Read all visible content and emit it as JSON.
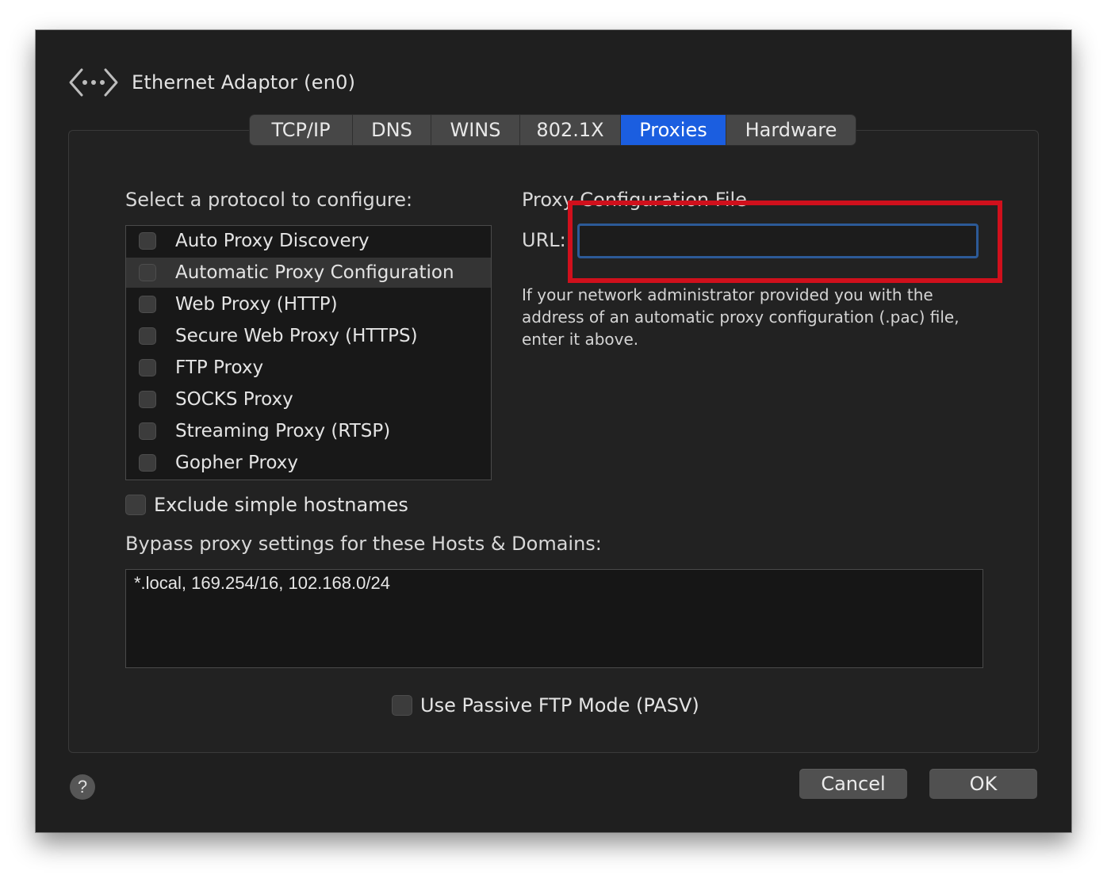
{
  "window": {
    "adaptor_icon": "network-arrows-icon",
    "title": "Ethernet Adaptor (en0)"
  },
  "tabs": [
    {
      "label": "TCP/IP",
      "active": false
    },
    {
      "label": "DNS",
      "active": false
    },
    {
      "label": "WINS",
      "active": false
    },
    {
      "label": "802.1X",
      "active": false
    },
    {
      "label": "Proxies",
      "active": true
    },
    {
      "label": "Hardware",
      "active": false
    }
  ],
  "protocols": {
    "heading": "Select a protocol to configure:",
    "items": [
      {
        "label": "Auto Proxy Discovery",
        "checked": false,
        "selected": false
      },
      {
        "label": "Automatic Proxy Configuration",
        "checked": false,
        "selected": true
      },
      {
        "label": "Web Proxy (HTTP)",
        "checked": false,
        "selected": false
      },
      {
        "label": "Secure Web Proxy (HTTPS)",
        "checked": false,
        "selected": false
      },
      {
        "label": "FTP Proxy",
        "checked": false,
        "selected": false
      },
      {
        "label": "SOCKS Proxy",
        "checked": false,
        "selected": false
      },
      {
        "label": "Streaming Proxy (RTSP)",
        "checked": false,
        "selected": false
      },
      {
        "label": "Gopher Proxy",
        "checked": false,
        "selected": false
      }
    ]
  },
  "config": {
    "heading": "Proxy Configuration File",
    "url_label": "URL:",
    "url_value": "",
    "help_text": "If your network administrator provided you with the address of an automatic proxy configuration (.pac) file, enter it above."
  },
  "exclude_simple": {
    "label": "Exclude simple hostnames",
    "checked": false
  },
  "bypass": {
    "label": "Bypass proxy settings for these Hosts & Domains:",
    "value": "*.local, 169.254/16, 102.168.0/24"
  },
  "passive_ftp": {
    "label": "Use Passive FTP Mode (PASV)",
    "checked": false
  },
  "footer": {
    "help_label": "?",
    "cancel_label": "Cancel",
    "ok_label": "OK"
  },
  "colors": {
    "accent": "#1b5ee0",
    "annotation": "#d0101c",
    "background": "#1f1f1f"
  }
}
